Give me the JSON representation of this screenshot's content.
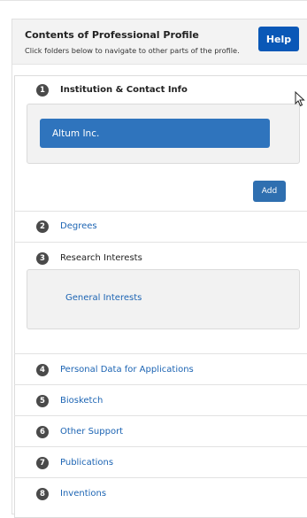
{
  "header": {
    "title": "Contents of Professional Profile",
    "subtitle": "Click folders below to navigate to other parts of the profile.",
    "help_label": "Help"
  },
  "sections": [
    {
      "num": "1",
      "label": "Institution & Contact Info"
    },
    {
      "num": "2",
      "label": "Degrees"
    },
    {
      "num": "3",
      "label": "Research Interests"
    },
    {
      "num": "4",
      "label": "Personal Data for Applications"
    },
    {
      "num": "5",
      "label": "Biosketch"
    },
    {
      "num": "6",
      "label": "Other Support"
    },
    {
      "num": "7",
      "label": "Publications"
    },
    {
      "num": "8",
      "label": "Inventions"
    }
  ],
  "institution": {
    "name": "Altum Inc.",
    "add_label": "Add"
  },
  "research": {
    "general_interests": "General Interests"
  },
  "colors": {
    "primary_button": "#0a58b7",
    "link": "#1c64b3",
    "number_badge": "#4a4a4a"
  }
}
